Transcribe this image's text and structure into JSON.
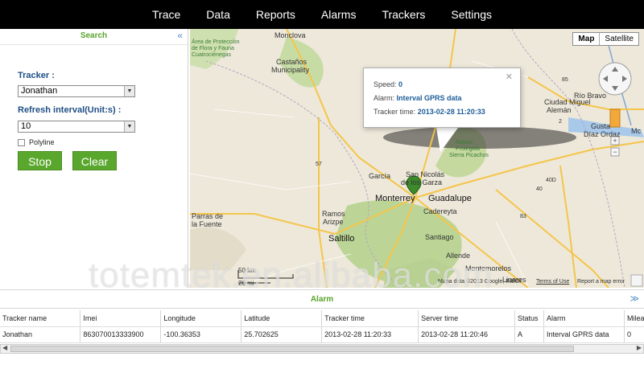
{
  "nav": {
    "items": [
      "Trace",
      "Data",
      "Reports",
      "Alarms",
      "Trackers",
      "Settings"
    ]
  },
  "search": {
    "title": "Search",
    "tracker_label": "Tracker :",
    "tracker_value": "Jonathan",
    "refresh_label": "Refresh interval(Unit:s) :",
    "refresh_value": "10",
    "polyline_label": "Polyline",
    "stop_label": "Stop",
    "clear_label": "Clear"
  },
  "map": {
    "type_map": "Map",
    "type_satellite": "Satellite",
    "popup": {
      "speed_label": "Speed:",
      "speed_value": "0",
      "alarm_label": "Alarm:",
      "alarm_value": "Interval GPRS data",
      "time_label": "Tracker time:",
      "time_value": "2013-02-28 11:20:33"
    },
    "labels": {
      "monclova": "Monclova",
      "castanos": "Castaños",
      "municipality": "Municipality",
      "proteccion": "Área de Protección",
      "flora": "de Flora y Fauna",
      "cuatro": "Cuatrociénegas",
      "rio_bravo": "Río Bravo",
      "ciudad_miguel": "Ciudad Miguel",
      "aleman": "Alemán",
      "guste": "Gusta",
      "diaz_ordaz": "Díaz Ordaz",
      "mc": "Mc",
      "natura": "Natura",
      "protegida": "Protegida",
      "picachos": "Sierra Picachos",
      "garcia": "García",
      "san_nicolas": "San Nicolás",
      "de_los_garza": "de los Garza",
      "monterrey": "Monterrey",
      "guadalupe": "Guadalupe",
      "cadereyta": "Cadereyta",
      "parras": "Parras de",
      "la_fuente": "la Fuente",
      "ramos": "Ramos",
      "arizpe": "Arizpe",
      "saltillo": "Saltillo",
      "santiago": "Santiago",
      "allende": "Allende",
      "montemorelos": "Montemorelos",
      "linares": "Linares",
      "scale_km": "50 km",
      "scale_mi": "20 mi",
      "copyright": "Mapa data ©2013 Google, INEGI",
      "terms": "Terms of Use",
      "report": "Report a map error",
      "route57": "57",
      "route85": "85",
      "route2": "2",
      "route40": "40",
      "route40d": "40D",
      "route53": "53",
      "route83": "83"
    }
  },
  "alarm": {
    "title": "Alarm",
    "columns": [
      "Tracker name",
      "Imei",
      "Longitude",
      "Latitude",
      "Tracker time",
      "Server time",
      "Status",
      "Alarm",
      "Milea"
    ],
    "rows": [
      [
        "Jonathan",
        "863070013333900",
        "-100.36353",
        "25.702625",
        "2013-02-28 11:20:33",
        "2013-02-28 11:20:46",
        "A",
        "Interval GPRS data",
        "0"
      ]
    ]
  },
  "watermark": "totemtek.en.alibaba.com",
  "colors": {
    "accent_green": "#5aa72d",
    "label_blue": "#1f4f85",
    "nav_bg": "#000000"
  }
}
